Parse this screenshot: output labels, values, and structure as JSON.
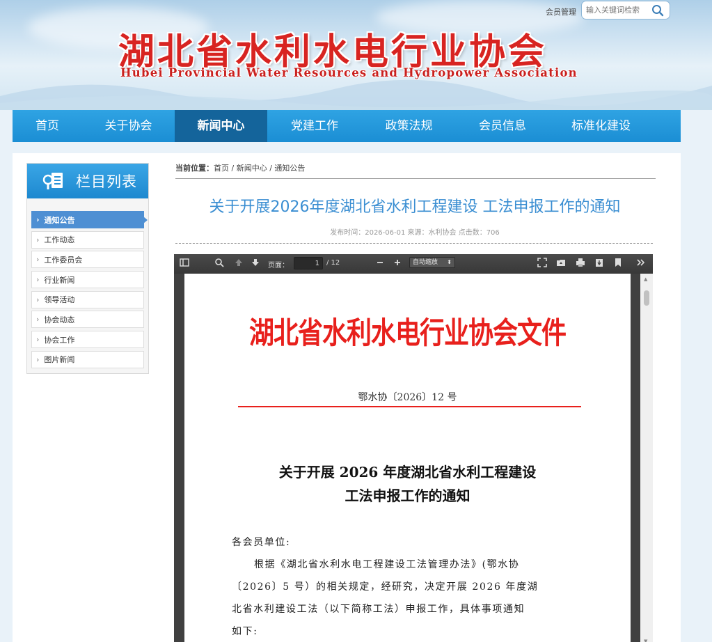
{
  "header": {
    "member_link": "会员管理",
    "search_placeholder": "输入关键词检索",
    "logo_cn": "湖北省水利水电行业协会",
    "logo_en": "Hubei Provincial Water Resources and Hydropower Association"
  },
  "nav": {
    "items": [
      {
        "label": "首页"
      },
      {
        "label": "关于协会"
      },
      {
        "label": "新闻中心"
      },
      {
        "label": "党建工作"
      },
      {
        "label": "政策法规"
      },
      {
        "label": "会员信息"
      },
      {
        "label": "标准化建设"
      }
    ],
    "active": "新闻中心"
  },
  "sidebar": {
    "title": "栏目列表",
    "items": [
      {
        "label": "通知公告"
      },
      {
        "label": "工作动态"
      },
      {
        "label": "工作委员会"
      },
      {
        "label": "行业新闻"
      },
      {
        "label": "领导活动"
      },
      {
        "label": "协会动态"
      },
      {
        "label": "协会工作"
      },
      {
        "label": "图片新闻"
      }
    ],
    "active": "通知公告"
  },
  "breadcrumb": {
    "label": "当前位置：",
    "path": "首页 / 新闻中心 / 通知公告"
  },
  "article": {
    "title": "关于开展2026年度湖北省水利工程建设 工法申报工作的通知",
    "meta": "发布时间：2026-06-01  来源：水利协会  点击数：706"
  },
  "pdf_viewer": {
    "page_label": "页面：",
    "current_page": "1",
    "total_pages": "/ 12",
    "zoom": "自动缩放",
    "document": {
      "header": "湖北省水利水电行业协会文件",
      "doc_number": "鄂水协〔2026〕12 号",
      "title_line1": "关于开展 2026 年度湖北省水利工程建设",
      "title_line2": "工法申报工作的通知",
      "salutation": "各会员单位:",
      "body_lines": [
        "根据《湖北省水利水电工程建设工法管理办法》(鄂水协",
        "〔2026〕5 号）的相关规定，经研究，决定开展 2026 年度湖",
        "北省水利建设工法（以下简称工法）申报工作，具体事项通知",
        "如下:"
      ]
    }
  },
  "colors": {
    "nav_blue": "#1b8ed4",
    "nav_active": "#14649b",
    "title_blue": "#3a8ed2",
    "logo_red": "#d82421"
  }
}
